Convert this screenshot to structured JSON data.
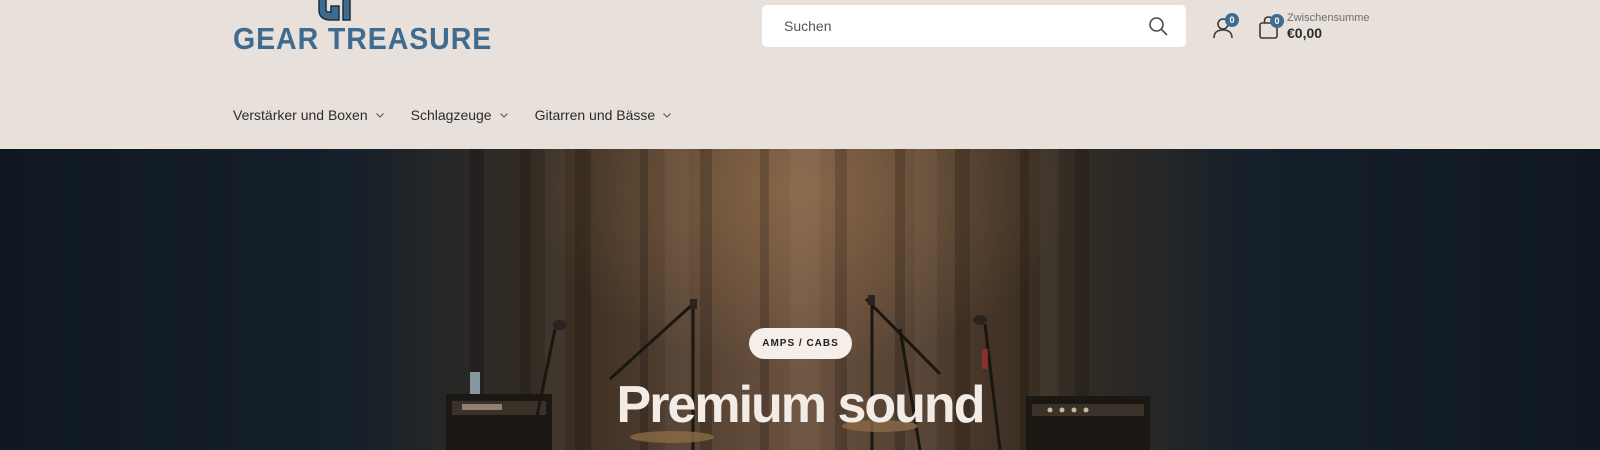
{
  "brand": {
    "name": "GEAR TREASURE",
    "mark": "GT",
    "color": "#3f6b8f"
  },
  "search": {
    "placeholder": "Suchen",
    "icon": "search-icon"
  },
  "account": {
    "icon": "user-icon",
    "count": "0"
  },
  "cart": {
    "icon": "shopping-bag-icon",
    "count": "0",
    "subtotal_label": "Zwischensumme",
    "subtotal_value": "€0,00"
  },
  "nav": {
    "items": [
      {
        "label": "Verstärker und Boxen",
        "icon": "chevron-down-icon"
      },
      {
        "label": "Schlagzeuge",
        "icon": "chevron-down-icon"
      },
      {
        "label": "Gitarren und Bässe",
        "icon": "chevron-down-icon"
      }
    ]
  },
  "hero": {
    "tag": "AMPS / CABS",
    "title": "Premium sound"
  },
  "colors": {
    "header_bg": "#e8e1db",
    "accent": "#3f6b8f",
    "hero_text": "#f3ece6"
  }
}
